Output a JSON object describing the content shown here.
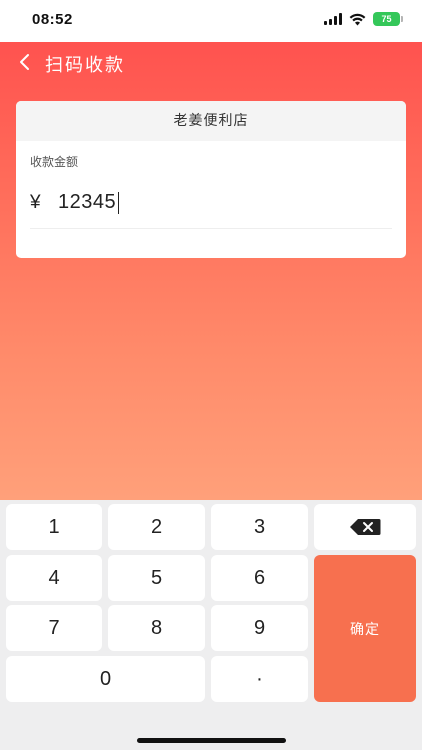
{
  "status_bar": {
    "time": "08:52",
    "battery": "75"
  },
  "nav": {
    "title": "扫码收款"
  },
  "card": {
    "store_name": "老姜便利店",
    "amount_label": "收款金额",
    "currency_symbol": "¥",
    "amount_value": "12345"
  },
  "keypad": {
    "keys": [
      "1",
      "2",
      "3",
      "4",
      "5",
      "6",
      "7",
      "8",
      "9",
      "0",
      "·"
    ],
    "confirm_label": "确定",
    "delete_icon": "backspace-icon"
  },
  "colors": {
    "gradient_top": "#ff4b4c",
    "gradient_bottom": "#ffa07a",
    "confirm": "#f7704f"
  }
}
